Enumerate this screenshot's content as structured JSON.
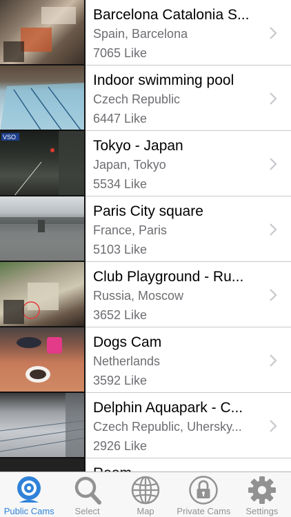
{
  "cams": [
    {
      "title": "Barcelona Catalonia S...",
      "location": "Spain, Barcelona",
      "likes": "7065 Like"
    },
    {
      "title": "Indoor swimming pool",
      "location": "Czech Republic",
      "likes": "6447 Like"
    },
    {
      "title": "Tokyo - Japan",
      "location": "Japan, Tokyo",
      "likes": "5534 Like"
    },
    {
      "title": "Paris City square",
      "location": "France, Paris",
      "likes": "5103 Like"
    },
    {
      "title": "Club Playground - Ru...",
      "location": "Russia, Moscow",
      "likes": "3652 Like"
    },
    {
      "title": "Dogs Cam",
      "location": "Netherlands",
      "likes": "3592 Like"
    },
    {
      "title": "Delphin Aquapark  - C...",
      "location": "Czech Republic, Uhersky...",
      "likes": "2926 Like"
    },
    {
      "title": "Room",
      "location": "",
      "likes": ""
    }
  ],
  "thumb_overlay_text": {
    "tokyo": "VSO"
  },
  "tabbar": {
    "tabs": [
      {
        "label": "Public Cams",
        "icon": "webcam-icon",
        "active": true
      },
      {
        "label": "Select",
        "icon": "search-icon",
        "active": false
      },
      {
        "label": "Map",
        "icon": "globe-icon",
        "active": false
      },
      {
        "label": "Private Cams",
        "icon": "lock-icon",
        "active": false
      },
      {
        "label": "Settings",
        "icon": "gear-icon",
        "active": false
      }
    ]
  },
  "colors": {
    "accent": "#2f82d8",
    "inactive": "#929292",
    "separator": "#c8c7cc",
    "secondary_text": "#6d6d72"
  }
}
